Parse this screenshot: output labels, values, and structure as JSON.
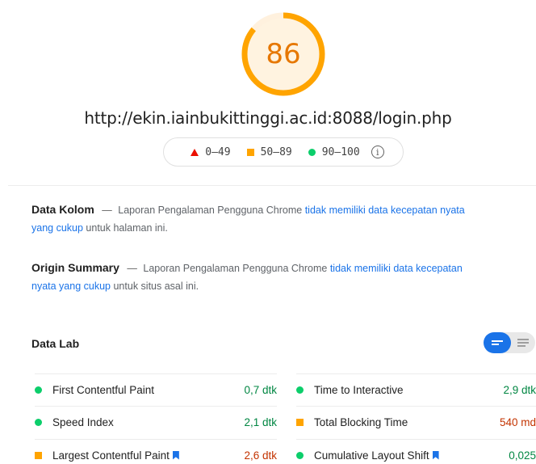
{
  "score": {
    "value": "86",
    "fraction": 0.86,
    "color": "#ffa400",
    "text_color": "#e67700"
  },
  "url": "http://ekin.iainbukittinggi.ac.id:8088/login.php",
  "legend": {
    "fail": "0–49",
    "average": "50–89",
    "pass": "90–100",
    "info_icon": "info-icon"
  },
  "field_data": {
    "title": "Data Kolom",
    "dash": "—",
    "prefix": "Laporan Pengalaman Pengguna Chrome",
    "link": "tidak memiliki data kecepatan nyata yang cukup",
    "suffix": "untuk halaman ini."
  },
  "origin_summary": {
    "title": "Origin Summary",
    "dash": "—",
    "prefix": "Laporan Pengalaman Pengguna Chrome",
    "link": "tidak memiliki data kecepatan nyata yang cukup",
    "suffix": "untuk situs asal ini."
  },
  "lab": {
    "title": "Data Lab",
    "metrics_left": [
      {
        "name": "First Contentful Paint",
        "value": "0,7 dtk",
        "status": "pass"
      },
      {
        "name": "Speed Index",
        "value": "2,1 dtk",
        "status": "pass"
      },
      {
        "name": "Largest Contentful Paint",
        "value": "2,6 dtk",
        "status": "average"
      }
    ],
    "metrics_right": [
      {
        "name": "Time to Interactive",
        "value": "2,9 dtk",
        "status": "pass"
      },
      {
        "name": "Total Blocking Time",
        "value": "540 md",
        "status": "average"
      },
      {
        "name": "Cumulative Layout Shift",
        "value": "0,025",
        "status": "pass"
      }
    ]
  },
  "colors": {
    "pass": "#0cce6b",
    "average": "#ffa400",
    "fail": "#eb0f00",
    "link": "#1a73e8",
    "pass_text": "#018642",
    "average_text": "#c33300"
  }
}
